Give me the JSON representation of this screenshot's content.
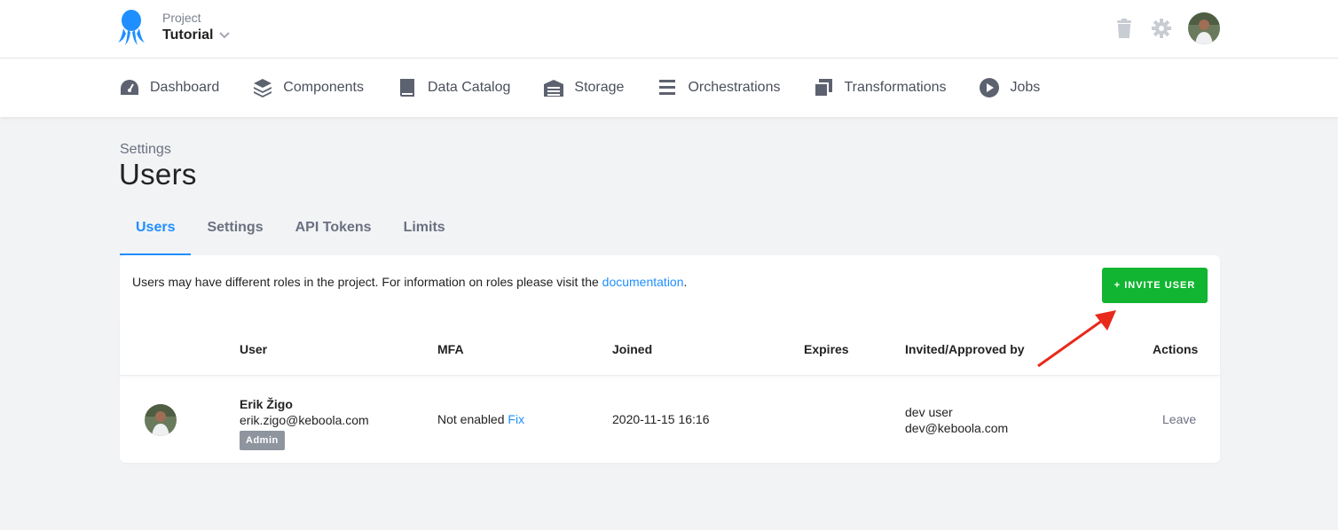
{
  "header": {
    "project_label": "Project",
    "project_name": "Tutorial",
    "icons": [
      "trash-icon",
      "gear-icon",
      "user-avatar"
    ]
  },
  "nav": {
    "items": [
      {
        "label": "Dashboard",
        "icon": "dashboard-icon"
      },
      {
        "label": "Components",
        "icon": "layers-icon"
      },
      {
        "label": "Data Catalog",
        "icon": "book-icon"
      },
      {
        "label": "Storage",
        "icon": "warehouse-icon"
      },
      {
        "label": "Orchestrations",
        "icon": "bars-icon"
      },
      {
        "label": "Transformations",
        "icon": "copy-icon"
      },
      {
        "label": "Jobs",
        "icon": "play-circle-icon"
      }
    ]
  },
  "page": {
    "breadcrumb": "Settings",
    "title": "Users"
  },
  "tabs": [
    {
      "label": "Users",
      "active": true
    },
    {
      "label": "Settings",
      "active": false
    },
    {
      "label": "API Tokens",
      "active": false
    },
    {
      "label": "Limits",
      "active": false
    }
  ],
  "panel": {
    "info_text": "Users may have different roles in the project. For information on roles please visit the ",
    "info_link": "documentation",
    "info_end": ".",
    "invite_label": "+ INVITE USER"
  },
  "table": {
    "headers": {
      "user": "User",
      "mfa": "MFA",
      "joined": "Joined",
      "expires": "Expires",
      "invited": "Invited/Approved by",
      "actions": "Actions"
    },
    "rows": [
      {
        "name": "Erik Žigo",
        "email": "erik.zigo@keboola.com",
        "role": "Admin",
        "mfa": "Not enabled",
        "mfa_fix": "Fix",
        "joined": "2020-11-15 16:16",
        "expires": "",
        "invited_by_name": "dev user",
        "invited_by_email": "dev@keboola.com",
        "action": "Leave"
      }
    ]
  },
  "colors": {
    "accent": "#1f8fff",
    "invite_green": "#12b532",
    "arrow_red": "#e8291c"
  }
}
